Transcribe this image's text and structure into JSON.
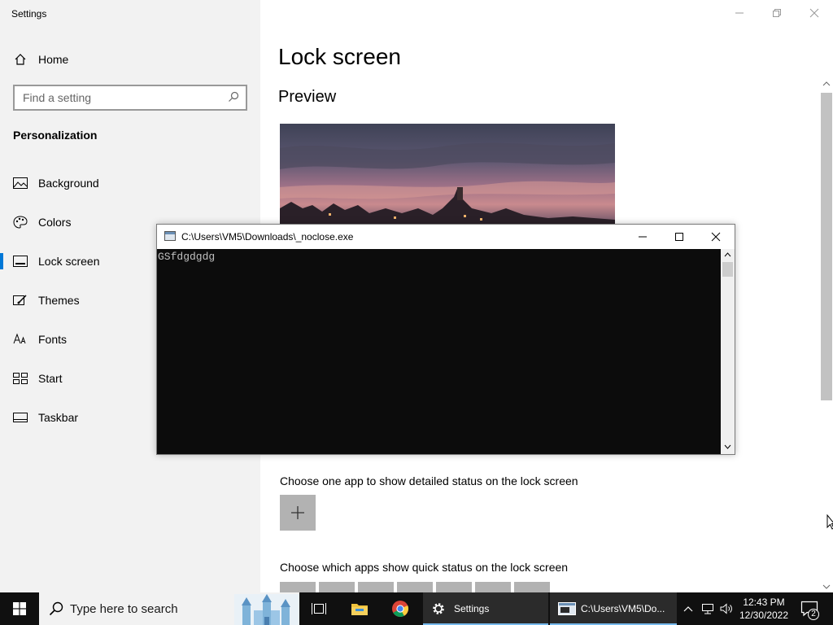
{
  "settings": {
    "window_title": "Settings",
    "nav_home": "Home",
    "search_placeholder": "Find a setting",
    "section": "Personalization",
    "nav_items": [
      {
        "label": "Background",
        "icon": "picture-icon"
      },
      {
        "label": "Colors",
        "icon": "palette-icon"
      },
      {
        "label": "Lock screen",
        "icon": "lock-screen-icon",
        "active": true
      },
      {
        "label": "Themes",
        "icon": "brush-icon"
      },
      {
        "label": "Fonts",
        "icon": "font-icon"
      },
      {
        "label": "Start",
        "icon": "start-icon"
      },
      {
        "label": "Taskbar",
        "icon": "taskbar-icon"
      }
    ],
    "page_title": "Lock screen",
    "preview_heading": "Preview",
    "detailed_status_label": "Choose one app to show detailed status on the lock screen",
    "quick_status_label": "Choose which apps show quick status on the lock screen",
    "accent_color": "#0078d7"
  },
  "console": {
    "title": "C:\\Users\\VM5\\Downloads\\_noclose.exe",
    "output": "GSfdgdgdg",
    "background": "#0c0c0c",
    "text_color": "#c0c0c0"
  },
  "taskbar": {
    "search_placeholder": "Type here to search",
    "settings_label": "Settings",
    "console_label": "C:\\Users\\VM5\\Do...",
    "time": "12:43 PM",
    "date": "12/30/2022",
    "notification_count": "2"
  }
}
